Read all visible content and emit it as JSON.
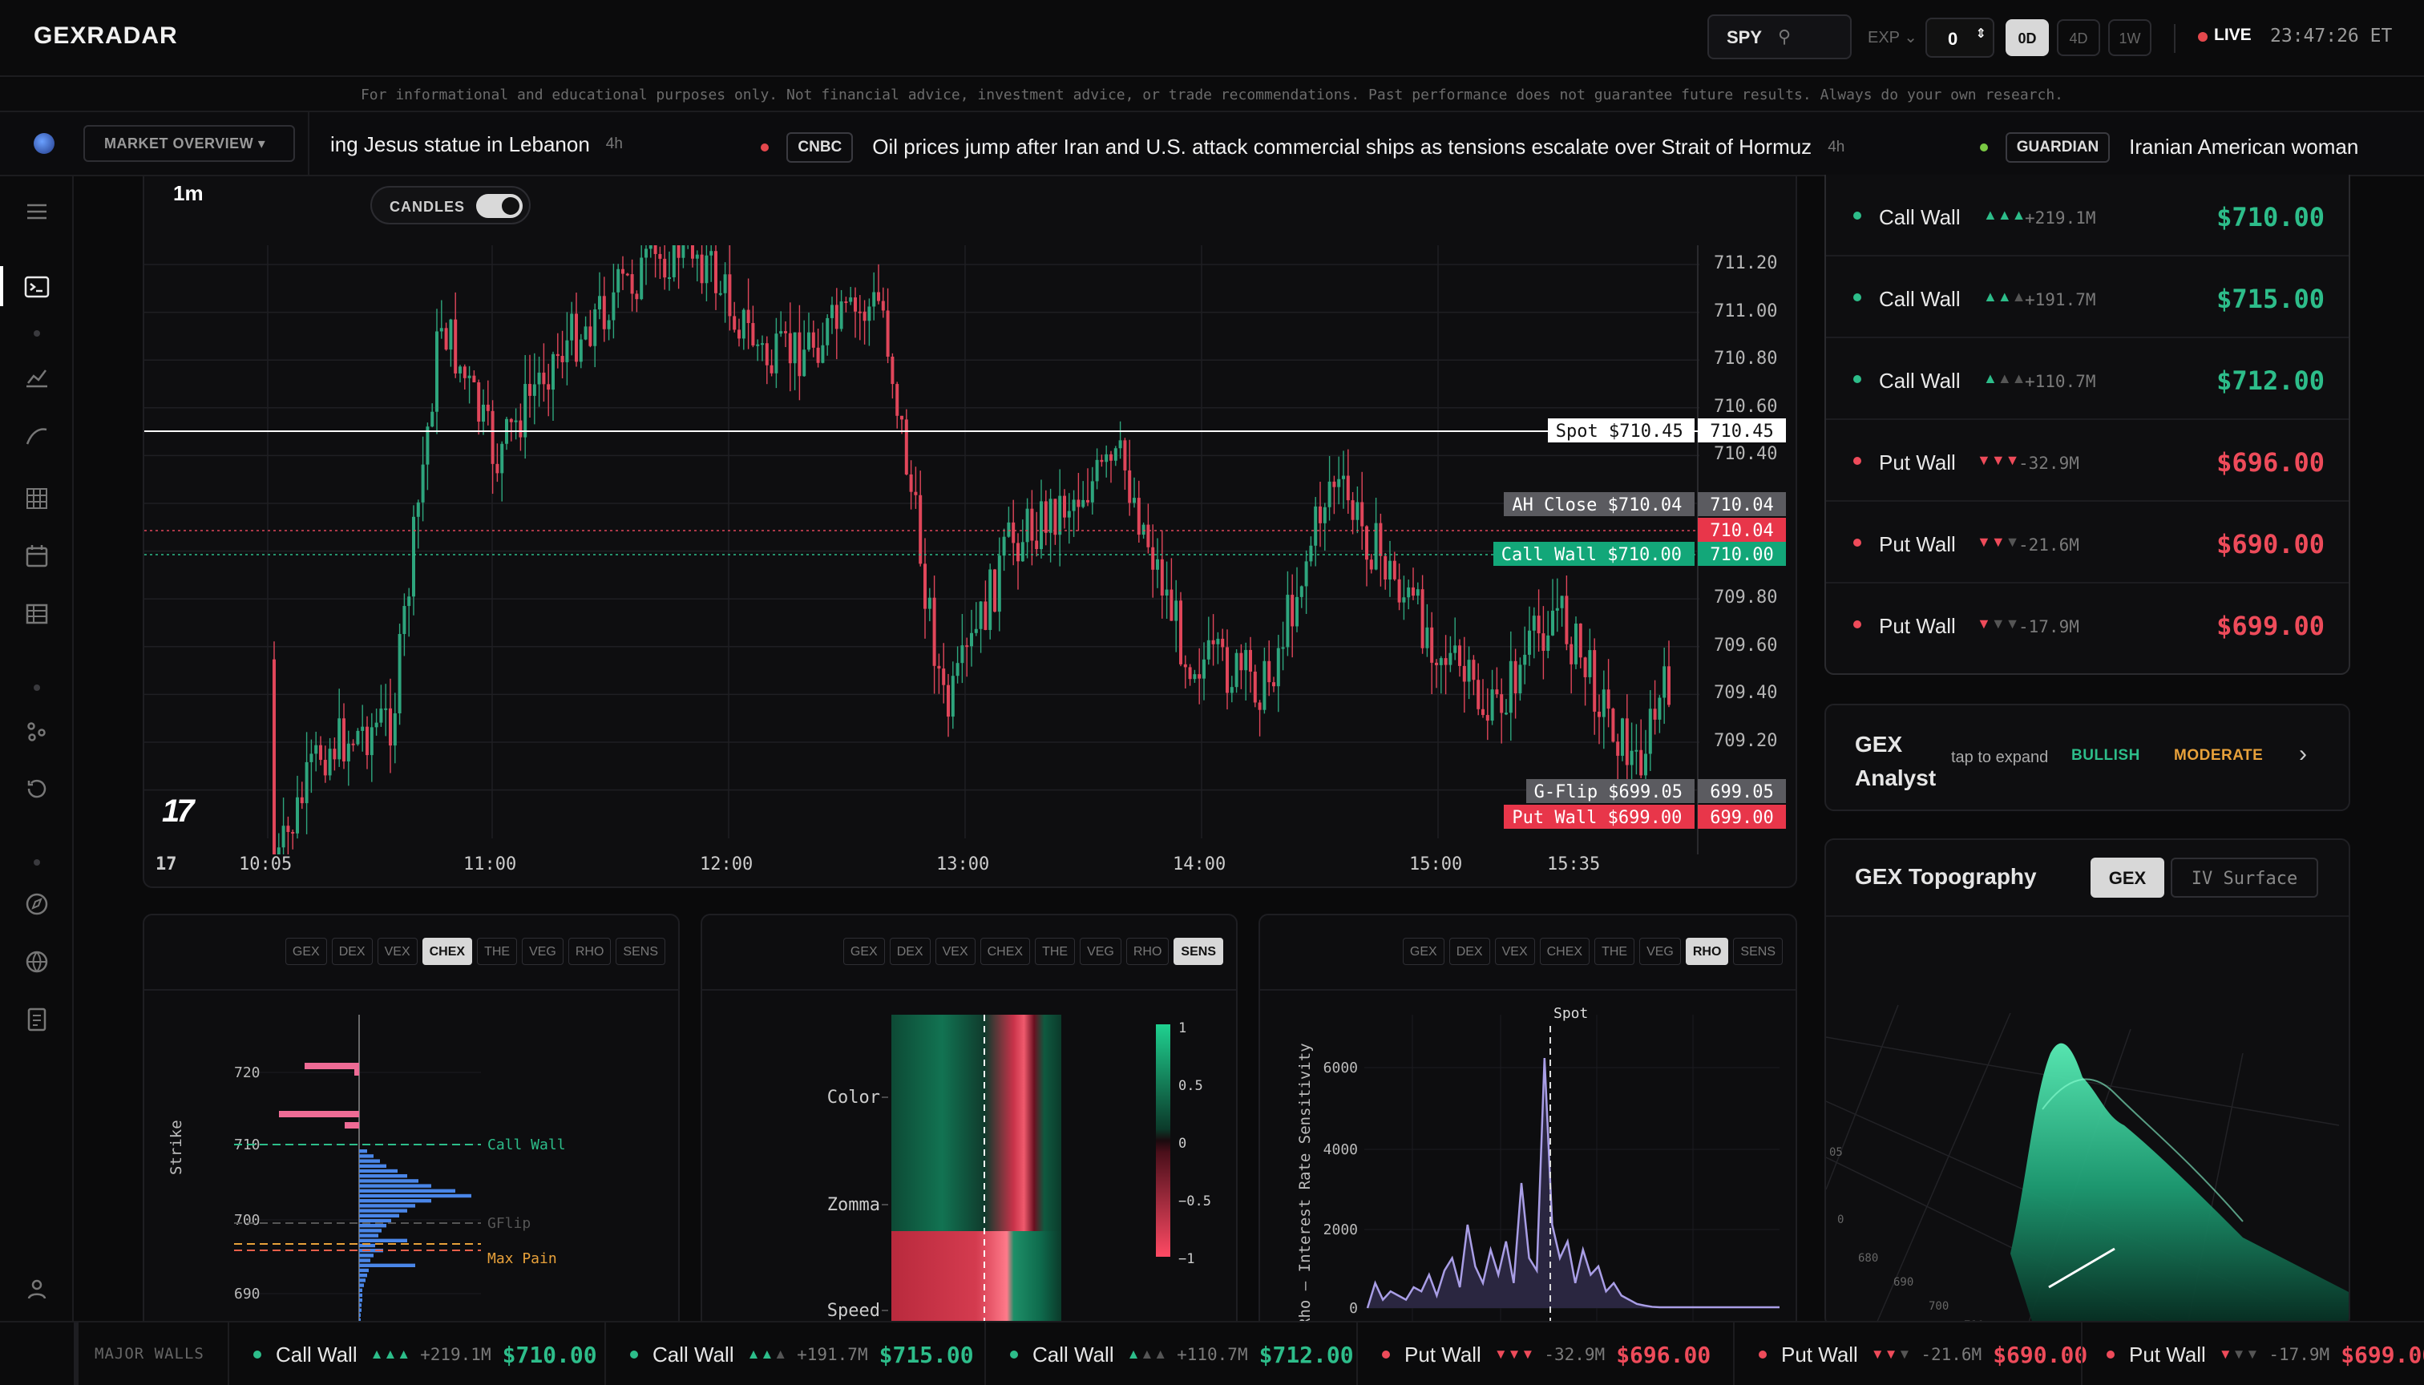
{
  "app": {
    "logo": "GEXRADAR"
  },
  "header": {
    "ticker": "SPY",
    "exp_label": "EXP",
    "exp_value": "0",
    "exp_buttons": [
      {
        "label": "0D",
        "active": true
      },
      {
        "label": "4D",
        "active": false
      },
      {
        "label": "1W",
        "active": false
      }
    ],
    "live_label": "LIVE",
    "clock": "23:47:26 ET"
  },
  "disclaimer": "For informational and educational purposes only. Not financial advice, investment advice, or trade recommendations. Past performance does not guarantee future results. Always do your own research.",
  "news": {
    "market_button": "MARKET OVERVIEW",
    "items": [
      {
        "source": "",
        "headline": "ing Jesus statue in Lebanon",
        "age": "4h",
        "dot": ""
      },
      {
        "source": "CNBC",
        "headline": "Oil prices jump after Iran and U.S. attack commercial ships as tensions escalate over Strait of Hormuz",
        "age": "4h",
        "dot": "#e5484d"
      },
      {
        "source": "GUARDIAN",
        "headline": "Iranian American woman",
        "age": "",
        "dot": "#7ac943"
      }
    ]
  },
  "chart": {
    "timeframe": "1m",
    "candles_label": "CANDLES",
    "candles_on": true,
    "date_label": "17",
    "price_ticks": [
      "711.20",
      "711.00",
      "710.80",
      "710.60",
      "710.40",
      "710.20",
      "710.00",
      "709.80",
      "709.60",
      "709.40",
      "709.20",
      "709.00"
    ],
    "time_ticks": [
      "10:05",
      "11:00",
      "12:00",
      "13:00",
      "14:00",
      "15:00",
      "15:35"
    ],
    "levels": [
      {
        "label": "Spot $710.45",
        "value": "710.45",
        "kind": "spot"
      },
      {
        "label": "AH Close $710.04",
        "value": "710.04",
        "kind": "ah"
      },
      {
        "label": "",
        "value": "710.04",
        "kind": "last"
      },
      {
        "label": "Call Wall $710.00",
        "value": "710.00",
        "kind": "call"
      },
      {
        "label": "G-Flip $699.05",
        "value": "699.05",
        "kind": "gflip"
      },
      {
        "label": "Put Wall $699.00",
        "value": "699.00",
        "kind": "put"
      }
    ]
  },
  "panels": [
    {
      "tabs": [
        "GEX",
        "DEX",
        "VEX",
        "CHEX",
        "THE",
        "VEG",
        "RHO",
        "SENS"
      ],
      "active": "CHEX",
      "ylabel": "Strike",
      "yticks": [
        "720",
        "710",
        "700",
        "690"
      ],
      "annotations": [
        "Call Wall",
        "GFlip",
        "Max Pain"
      ]
    },
    {
      "tabs": [
        "GEX",
        "DEX",
        "VEX",
        "CHEX",
        "THE",
        "VEG",
        "RHO",
        "SENS"
      ],
      "active": "SENS",
      "rows": [
        "Color",
        "Zomma",
        "Speed"
      ],
      "scale": [
        "1",
        "0.5",
        "0",
        "−0.5",
        "−1"
      ]
    },
    {
      "tabs": [
        "GEX",
        "DEX",
        "VEX",
        "CHEX",
        "THE",
        "VEG",
        "RHO",
        "SENS"
      ],
      "active": "RHO",
      "ylabel": "Rho — Interest Rate Sensitivity",
      "yticks": [
        "6000",
        "4000",
        "2000",
        "0"
      ],
      "marker": "Spot"
    }
  ],
  "walls": [
    {
      "name": "Call Wall",
      "tri": "▲▲▲",
      "tri_on": 3,
      "amount": "+219.1M",
      "price": "$710.00",
      "type": "call"
    },
    {
      "name": "Call Wall",
      "tri": "▲▲▲",
      "tri_on": 2,
      "amount": "+191.7M",
      "price": "$715.00",
      "type": "call"
    },
    {
      "name": "Call Wall",
      "tri": "▲▲▲",
      "tri_on": 1,
      "amount": "+110.7M",
      "price": "$712.00",
      "type": "call"
    },
    {
      "name": "Put Wall",
      "tri": "▼▼▼",
      "tri_on": 3,
      "amount": "-32.9M",
      "price": "$696.00",
      "type": "put"
    },
    {
      "name": "Put Wall",
      "tri": "▼▼▼",
      "tri_on": 2,
      "amount": "-21.6M",
      "price": "$690.00",
      "type": "put"
    },
    {
      "name": "Put Wall",
      "tri": "▼▼▼",
      "tri_on": 1,
      "amount": "-17.9M",
      "price": "$699.00",
      "type": "put"
    }
  ],
  "analyst": {
    "title_line1": "GEX",
    "title_line2": "Analyst",
    "hint": "tap to expand",
    "bias": "BULLISH",
    "strength": "MODERATE"
  },
  "topography": {
    "title": "GEX Topography",
    "tabs": [
      {
        "label": "GEX",
        "active": true
      },
      {
        "label": "IV Surface",
        "active": false
      }
    ],
    "axis_labels": [
      "05",
      "0",
      "680",
      "690",
      "700",
      "710"
    ]
  },
  "walls_ticker": {
    "label": "MAJOR WALLS"
  },
  "colors": {
    "call": "#2dbd8a",
    "put": "#ee4b5a",
    "up": "#2ea57d",
    "down": "#e0465a",
    "accent_orange": "#e8a13a"
  }
}
